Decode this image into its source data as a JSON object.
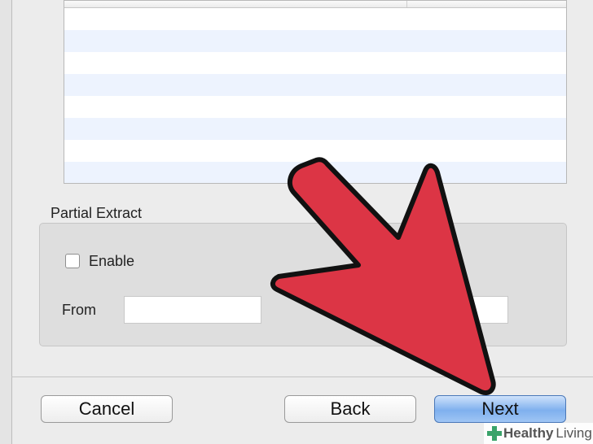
{
  "partial_extract": {
    "section_label": "Partial Extract",
    "enable_label": "Enable",
    "enable_checked": false,
    "from_label": "From",
    "from_value": "",
    "to_value": ""
  },
  "buttons": {
    "cancel": "Cancel",
    "back": "Back",
    "next": "Next"
  },
  "watermark": {
    "part1": "Healthy",
    "part2": "Living"
  },
  "colors": {
    "arrow_fill": "#dc3545",
    "next_button": "#7fb0ee",
    "row_stripe": "#edf3fe"
  }
}
